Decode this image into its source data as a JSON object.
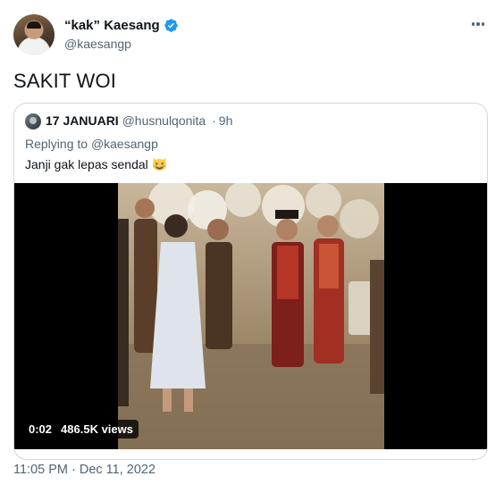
{
  "author": {
    "display_name": "“kak” Kaesang",
    "username": "@kaesangp",
    "verified": true,
    "verified_color": "#1d9bf0"
  },
  "tweet": {
    "text": "SAKIT WOI"
  },
  "quoted_tweet": {
    "display_name": "17 JANUARI",
    "username": "@husnulqonita",
    "separator": "·",
    "time": "9h",
    "replying_prefix": "Replying to",
    "replying_to": "@kaesangp",
    "text": "Janji gak lepas sendal",
    "emoji": "grinning-squinting-cat-face-icon"
  },
  "video": {
    "elapsed": "0:02",
    "views": "486.5K views"
  },
  "footer": {
    "time": "11:05 PM",
    "separator": "·",
    "date": "Dec 11, 2022"
  },
  "colors": {
    "text_primary": "#0f1419",
    "text_secondary": "#536471",
    "border": "#cfd9de"
  }
}
